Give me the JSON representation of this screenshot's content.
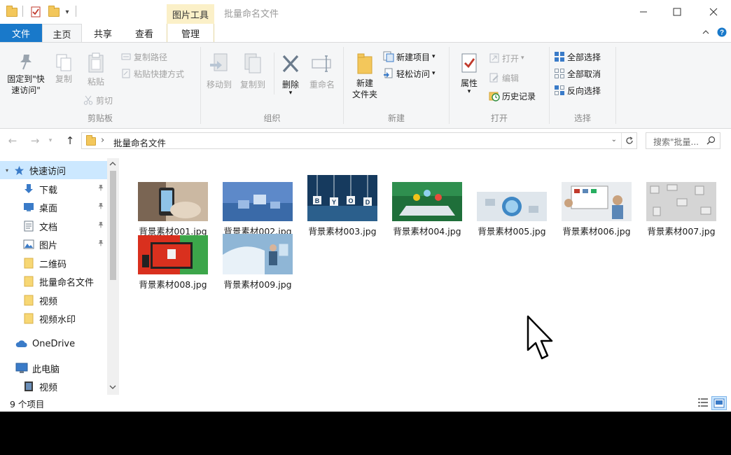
{
  "window": {
    "title": "批量命名文件",
    "contextual_tab": "图片工具",
    "controls": {
      "minimize": "—",
      "maximize": "☐",
      "close": "✕"
    }
  },
  "ribbon_tabs": {
    "file": "文件",
    "home": "主页",
    "share": "共享",
    "view": "查看",
    "manage": "管理"
  },
  "ribbon": {
    "clipboard": {
      "label": "剪贴板",
      "pin_quick_access": "固定到\"快\n速访问\"",
      "copy": "复制",
      "paste": "粘贴",
      "copy_path": "复制路径",
      "paste_shortcut": "粘贴快捷方式",
      "cut": "剪切"
    },
    "organize": {
      "label": "组织",
      "move_to": "移动到",
      "copy_to": "复制到",
      "delete": "删除",
      "rename": "重命名"
    },
    "new": {
      "label": "新建",
      "new_folder": "新建\n文件夹",
      "new_item": "新建项目",
      "easy_access": "轻松访问"
    },
    "open": {
      "label": "打开",
      "properties": "属性",
      "open": "打开",
      "edit": "编辑",
      "history": "历史记录"
    },
    "select": {
      "label": "选择",
      "select_all": "全部选择",
      "select_none": "全部取消",
      "invert": "反向选择"
    }
  },
  "address": {
    "breadcrumb_sep": "›",
    "path": "批量命名文件",
    "search_placeholder": "搜索\"批量..."
  },
  "nav": {
    "quick_access": "快速访问",
    "items": [
      {
        "label": "下载",
        "icon": "download-icon",
        "pinned": true
      },
      {
        "label": "桌面",
        "icon": "desktop-icon",
        "pinned": true
      },
      {
        "label": "文档",
        "icon": "document-icon",
        "pinned": true
      },
      {
        "label": "图片",
        "icon": "pictures-icon",
        "pinned": true
      },
      {
        "label": "二维码",
        "icon": "folder-icon",
        "pinned": false
      },
      {
        "label": "批量命名文件",
        "icon": "folder-icon",
        "pinned": false
      },
      {
        "label": "视频",
        "icon": "folder-icon",
        "pinned": false
      },
      {
        "label": "视频水印",
        "icon": "folder-icon",
        "pinned": false
      }
    ],
    "onedrive": "OneDrive",
    "this_pc": "此电脑",
    "pc_videos": "视频"
  },
  "files": [
    {
      "name": "背景素材001.jpg",
      "thumb_colors": [
        "#c9b7a3",
        "#6b5a4a",
        "#ddd2c2"
      ]
    },
    {
      "name": "背景素材002.jpg",
      "thumb_colors": [
        "#5d89c9",
        "#9bbbe4",
        "#2f5ea3"
      ]
    },
    {
      "name": "背景素材003.jpg",
      "thumb_colors": [
        "#163a5e",
        "#2b5f8c",
        "#dfe8ef"
      ],
      "letters": [
        "B",
        "Y",
        "O",
        "D"
      ]
    },
    {
      "name": "背景素材004.jpg",
      "thumb_colors": [
        "#1f6f3a",
        "#3aa35a",
        "#8fd0f0"
      ]
    },
    {
      "name": "背景素材005.jpg",
      "thumb_colors": [
        "#dfe6ec",
        "#3f88c5",
        "#b9c7d3"
      ]
    },
    {
      "name": "背景素材006.jpg",
      "thumb_colors": [
        "#e9ecef",
        "#c0392b",
        "#5b87b7"
      ]
    },
    {
      "name": "背景素材007.jpg",
      "thumb_colors": [
        "#d5d5d5",
        "#9e9e9e",
        "#ececec"
      ]
    },
    {
      "name": "背景素材008.jpg",
      "thumb_colors": [
        "#d9301e",
        "#3ca64a",
        "#f2f2f2"
      ]
    },
    {
      "name": "背景素材009.jpg",
      "thumb_colors": [
        "#8fb6d6",
        "#e8f1f8",
        "#3b5e80"
      ]
    }
  ],
  "status": {
    "item_count": "9 个项目"
  }
}
